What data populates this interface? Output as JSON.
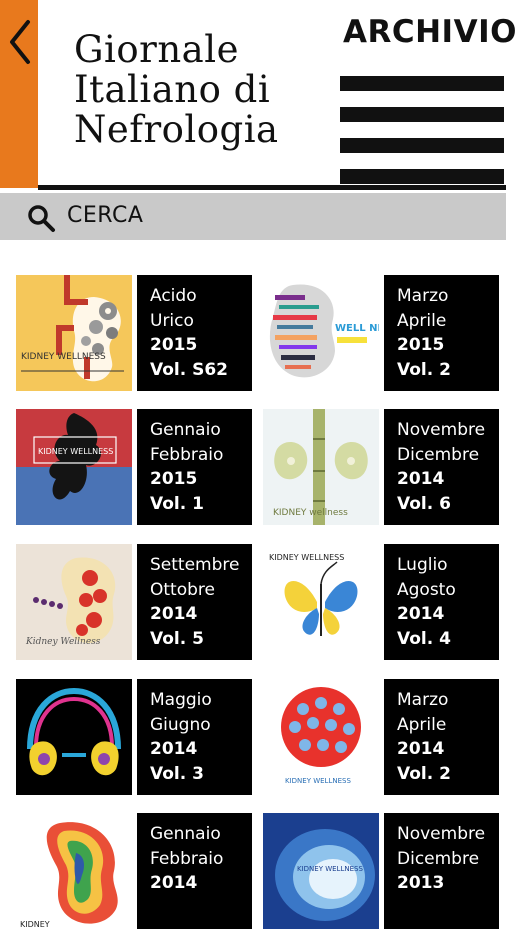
{
  "header": {
    "title_lines": [
      "Giornale",
      "Italiano di",
      "Nefrologia"
    ],
    "archive_label": "ARCHIVIO"
  },
  "search": {
    "label": "CERCA"
  },
  "colors": {
    "accent": "#e8791d",
    "tile": "#000000",
    "search_bg": "#c9c9c9"
  },
  "issues": [
    {
      "line1": "Acido",
      "line2": "Urico",
      "year": "2015",
      "volume": "Vol. S62",
      "cover": "kidney-pipes-gears",
      "cover_text": "KIDNEY WELLNESS"
    },
    {
      "line1": "Marzo",
      "line2": "Aprile",
      "year": "2015",
      "volume": "Vol. 2",
      "cover": "kidney-word-cloud",
      "cover_text": "WELL NESS!"
    },
    {
      "line1": "Gennaio",
      "line2": "Febbraio",
      "year": "2015",
      "volume": "Vol. 1",
      "cover": "ink-splash-red-blue",
      "cover_text": "KIDNEY WELLNESS"
    },
    {
      "line1": "Novembre",
      "line2": "Dicembre",
      "year": "2014",
      "volume": "Vol. 6",
      "cover": "bamboo-kidneys",
      "cover_text": "KIDNEY wellness"
    },
    {
      "line1": "Settembre",
      "line2": "Ottobre",
      "year": "2014",
      "volume": "Vol. 5",
      "cover": "pasta-kidney-tomatoes",
      "cover_text": "Kidney Wellness"
    },
    {
      "line1": "Luglio",
      "line2": "Agosto",
      "year": "2014",
      "volume": "Vol. 4",
      "cover": "butterfly-kidneys",
      "cover_text": "KIDNEY WELLNESS"
    },
    {
      "line1": "Maggio",
      "line2": "Giugno",
      "year": "2014",
      "volume": "Vol. 3",
      "cover": "headphones-kidneys",
      "cover_text": ""
    },
    {
      "line1": "Marzo",
      "line2": "Aprile",
      "year": "2014",
      "volume": "Vol. 2",
      "cover": "red-circle-dots",
      "cover_text": "KIDNEY WELLNESS"
    },
    {
      "line1": "Gennaio",
      "line2": "Febbraio",
      "year": "2014",
      "volume": "",
      "cover": "psychedelic-kidney",
      "cover_text": "KIDNEY"
    },
    {
      "line1": "Novembre",
      "line2": "Dicembre",
      "year": "2013",
      "volume": "",
      "cover": "blue-swirl",
      "cover_text": "KIDNEY WELLNESS"
    }
  ]
}
